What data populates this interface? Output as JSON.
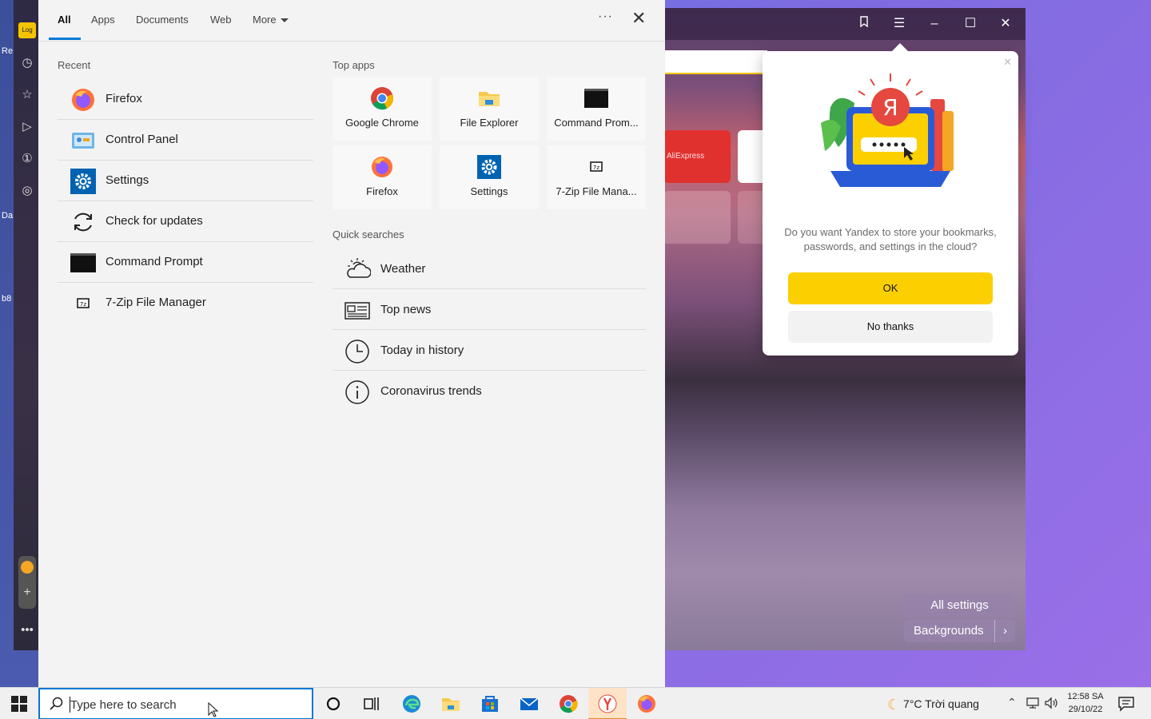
{
  "panel": {
    "tabs": [
      {
        "label": "All"
      },
      {
        "label": "Apps"
      },
      {
        "label": "Documents"
      },
      {
        "label": "Web"
      },
      {
        "label": "More"
      }
    ],
    "more_options": "···",
    "close": "✕",
    "recent": {
      "title": "Recent",
      "items": [
        {
          "label": "Firefox",
          "icon": "firefox-icon"
        },
        {
          "label": "Control Panel",
          "icon": "control-panel-icon"
        },
        {
          "label": "Settings",
          "icon": "settings-gear-icon"
        },
        {
          "label": "Check for updates",
          "icon": "refresh-icon"
        },
        {
          "label": "Command Prompt",
          "icon": "command-prompt-icon"
        },
        {
          "label": "7-Zip File Manager",
          "icon": "7zip-icon"
        }
      ]
    },
    "top_apps": {
      "title": "Top apps",
      "items": [
        {
          "label": "Google Chrome",
          "icon": "chrome-icon"
        },
        {
          "label": "File Explorer",
          "icon": "file-explorer-icon"
        },
        {
          "label": "Command Prom...",
          "icon": "command-prompt-icon"
        },
        {
          "label": "Firefox",
          "icon": "firefox-icon"
        },
        {
          "label": "Settings",
          "icon": "settings-gear-icon"
        },
        {
          "label": "7-Zip File Mana...",
          "icon": "7zip-icon"
        }
      ]
    },
    "quick_searches": {
      "title": "Quick searches",
      "items": [
        {
          "label": "Weather",
          "icon": "weather-icon"
        },
        {
          "label": "Top news",
          "icon": "news-icon"
        },
        {
          "label": "Today in history",
          "icon": "clock-icon"
        },
        {
          "label": "Coronavirus trends",
          "icon": "info-icon"
        }
      ]
    }
  },
  "browser": {
    "tile_label": "AliExpress",
    "all_settings": "All settings",
    "backgrounds": "Backgrounds",
    "popup": {
      "message": "Do you want Yandex to store your bookmarks, passwords, and settings in the cloud?",
      "ok": "OK",
      "no_thanks": "No thanks",
      "logo_letter": "Я"
    }
  },
  "desktop": {
    "labels": [
      "Re",
      "Da",
      "b8"
    ],
    "badge": "Log"
  },
  "taskbar": {
    "search_placeholder": "Type here to search",
    "weather": "7°C  Trời quang",
    "time": "12:58 SA",
    "date": "29/10/22"
  },
  "colors": {
    "accent": "#0078d4",
    "yandex_yellow": "#fcd000",
    "aliexpress_red": "#e0312f"
  }
}
